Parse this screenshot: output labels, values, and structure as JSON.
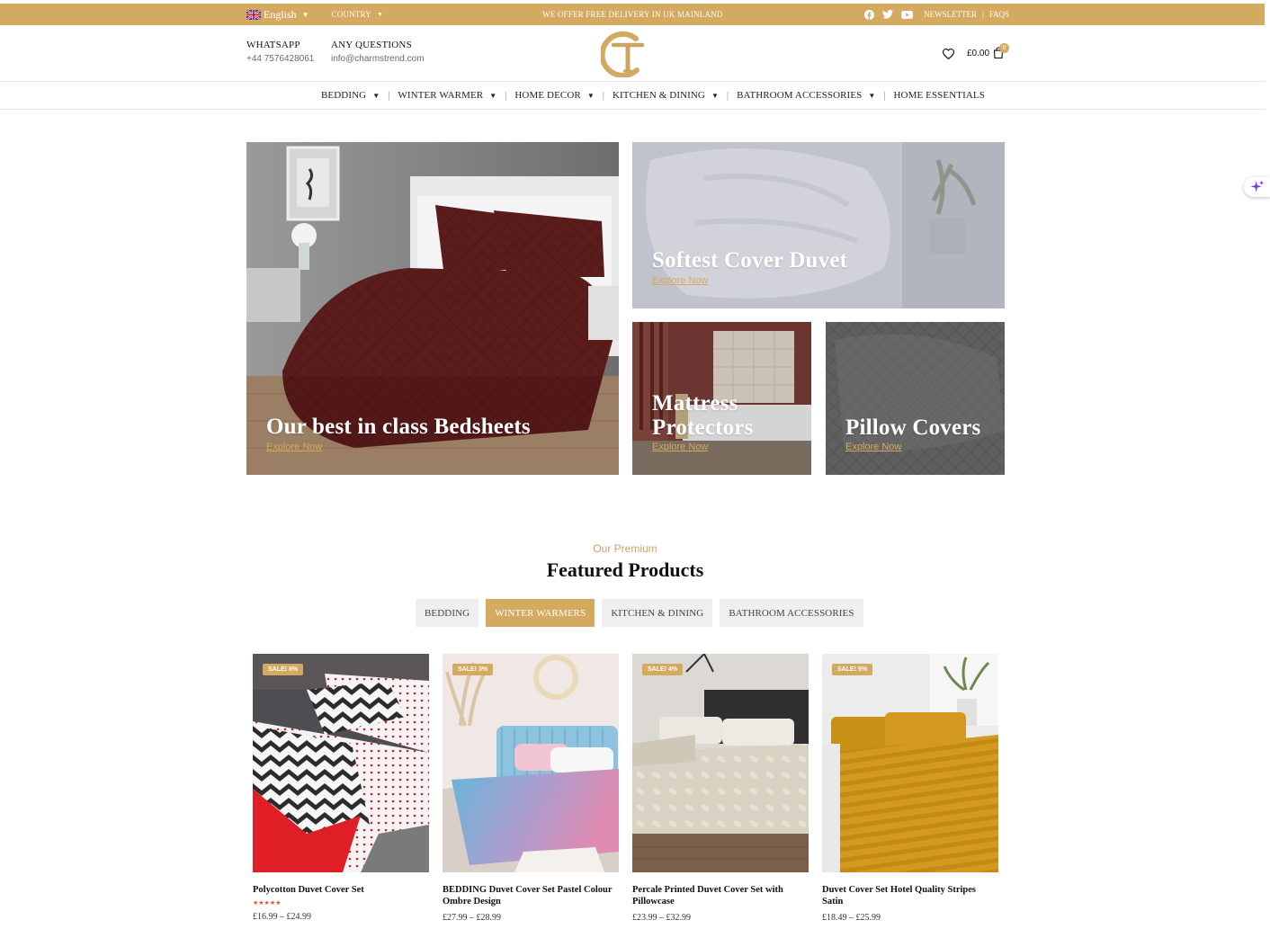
{
  "topbar": {
    "language": "English",
    "country": "COUNTRY",
    "delivery": "WE OFFER FREE DELIVERY IN UK MAINLAND",
    "newsletter": "NEWSLETTER",
    "separator": "|",
    "faqs": "FAQS",
    "bg_color": "#d4a960"
  },
  "header": {
    "whatsapp_title": "WHATSAPP",
    "whatsapp_value": "+44 7576428061",
    "questions_title": "ANY QUESTIONS",
    "questions_value": "info@charmstrend.com",
    "cart_total": "£0.00",
    "cart_count": "0"
  },
  "nav": {
    "items": [
      {
        "label": "BEDDING"
      },
      {
        "label": "WINTER WARMER"
      },
      {
        "label": "HOME DECOR"
      },
      {
        "label": "KITCHEN & DINING"
      },
      {
        "label": "BATHROOM ACCESSORIES"
      },
      {
        "label": "HOME ESSENTIALS"
      }
    ],
    "separator": "|"
  },
  "heroes": [
    {
      "title": "Our best in class Bedsheets",
      "link": "Explore Now"
    },
    {
      "title": "Softest Cover Duvet",
      "link": "Explore Now"
    },
    {
      "title": "Mattress Protectors",
      "link": "Explore Now"
    },
    {
      "title": "Pillow Covers",
      "link": "Explore Now"
    }
  ],
  "featured": {
    "kicker": "Our Premium",
    "title": "Featured Products",
    "tabs": [
      "BEDDING",
      "WINTER WARMERS",
      "KITCHEN & DINING",
      "BATHROOM ACCESSORIES"
    ],
    "active_tab": "WINTER WARMERS"
  },
  "products": [
    {
      "badge": "SALE! 8%",
      "name": "Polycotton Duvet Cover Set",
      "stars": "★★★★★",
      "rating": 5,
      "price": "£16.99 – £24.99"
    },
    {
      "badge": "SALE! 3%",
      "name": "BEDDING Duvet Cover Set Pastel Colour Ombre Design",
      "price": "£27.99 – £28.99"
    },
    {
      "badge": "SALE! 4%",
      "name": "Percale Printed Duvet Cover Set with Pillowcase",
      "price": "£23.99 – £32.99"
    },
    {
      "badge": "SALE! 5%",
      "name": "Duvet Cover Set Hotel Quality Stripes Satin",
      "price": "£18.49 – £25.99"
    }
  ],
  "colors": {
    "accent": "#d4a960",
    "rating": "#e0562f"
  }
}
